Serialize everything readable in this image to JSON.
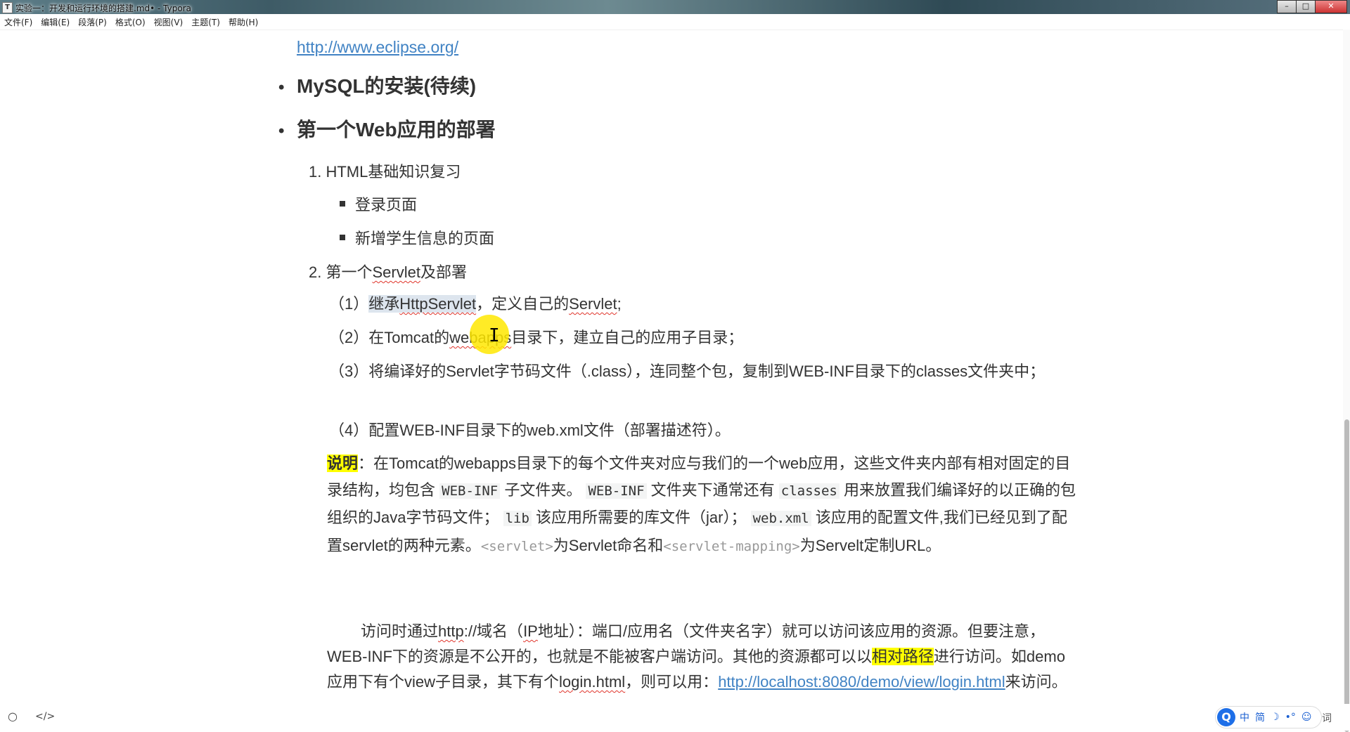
{
  "window": {
    "app_icon": "T",
    "title": "实验一：开发和运行环境的搭建.md• - Typora",
    "min": "–",
    "max": "□",
    "close": "✕"
  },
  "menu": [
    "文件(F)",
    "编辑(E)",
    "段落(P)",
    "格式(O)",
    "视图(V)",
    "主题(T)",
    "帮助(H)"
  ],
  "content": {
    "top_link": "http://www.eclipse.org/",
    "bullet1": "MySQL的安装(待续)",
    "bullet2": "第一个Web应用的部署",
    "ol1": "1. HTML基础知识复习",
    "sq1": "登录页面",
    "sq2": "新增学生信息的页面",
    "ol2_prefix": "2. 第一个",
    "ol2_servlet": "Servlet",
    "ol2_suffix": "及部署",
    "step1_a": "（1）",
    "step1_sel1": "继承",
    "step1_sel2": "HttpServlet",
    "step1_b": "，定义自己的",
    "step1_c": "Servlet",
    "step1_d": ";",
    "step2_a": "（2）在Tomcat的",
    "step2_b": "webapps",
    "step2_c": "目录下，建立自己的应用子目录；",
    "step3": "（3）将编译好的Servlet字节码文件（.class），连同整个包，复制到WEB-INF目录下的classes文件夹中；",
    "step4": "（4）配置WEB-INF目录下的web.xml文件（部署描述符）。",
    "note_label": "说明",
    "note_1": "：在Tomcat的webapps目录下的每个文件夹对应与我们的一个web应用，这些文件夹内部有相对固定的目录结构，均包含 ",
    "code_webinf": "WEB-INF",
    "note_2": " 子文件夹。 ",
    "code_webinf2": "WEB-INF",
    "note_3": " 文件夹下通常还有 ",
    "code_classes": "classes",
    "note_4": " 用来放置我们编译好的以正确的包组织的Java字节码文件； ",
    "code_lib": "lib",
    "note_5": " 该应用所需要的库文件（jar）； ",
    "code_webxml": "web.xml",
    "note_6": " 该应用的配置文件,我们已经见到了配置servlet的两种元素。",
    "tag_servlet": "<servlet>",
    "note_7": "为Servlet命名和",
    "tag_mapping": "<servlet-mapping>",
    "note_8": "为Servelt定制URL。",
    "para2_a": "访问时通过",
    "para2_http": "http",
    "para2_b": "://域名（",
    "para2_ip": "IP",
    "para2_c": "地址）：端口/应用名（文件夹名字）就可以访问该应用的资源。但要注意，WEB-INF下的资源是不公开的，也就是不能被客户端访问。其他的资源都可以以",
    "para2_hl": "相对路径",
    "para2_d": "进行访问。如demo应用下有个view子目录，其下有个",
    "para2_login": "login.html",
    "para2_e": "，则可以用：",
    "para2_link": "http://localhost:8080/demo/view/login.html",
    "para2_f": "来访问。"
  },
  "status": {
    "outline_icon": "○",
    "source_icon": "</>",
    "ime_logo": "Q",
    "ime_items": [
      "中",
      "简",
      "☽",
      "•°",
      "☺"
    ],
    "ime_tail": "词"
  }
}
